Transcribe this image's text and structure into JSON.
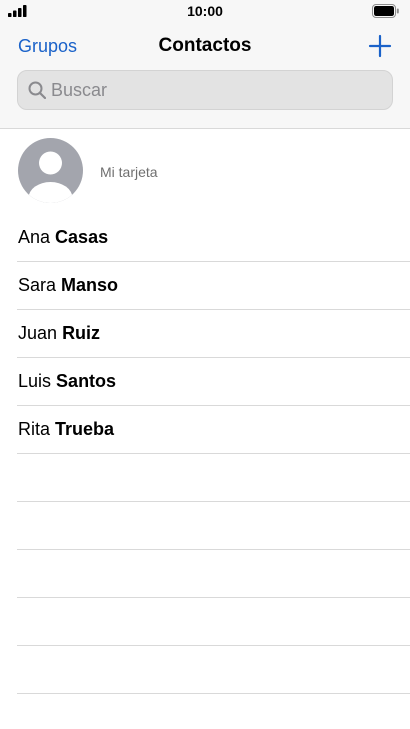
{
  "status_bar": {
    "time": "10:00",
    "signal_icon": "cellular-signal-icon",
    "battery_icon": "battery-icon"
  },
  "nav": {
    "groups_label": "Grupos",
    "title": "Contactos",
    "add_icon": "plus-icon",
    "accent_color": "#1a62c9"
  },
  "search": {
    "placeholder": "Buscar",
    "value": "",
    "icon": "search-icon"
  },
  "my_card": {
    "label": "Mi tarjeta",
    "avatar_icon": "person-avatar-icon"
  },
  "contacts": [
    {
      "first": "Ana",
      "last": "Casas"
    },
    {
      "first": "Sara",
      "last": "Manso"
    },
    {
      "first": "Juan",
      "last": "Ruiz"
    },
    {
      "first": "Luis",
      "last": "Santos"
    },
    {
      "first": "Rita",
      "last": "Trueba"
    }
  ]
}
